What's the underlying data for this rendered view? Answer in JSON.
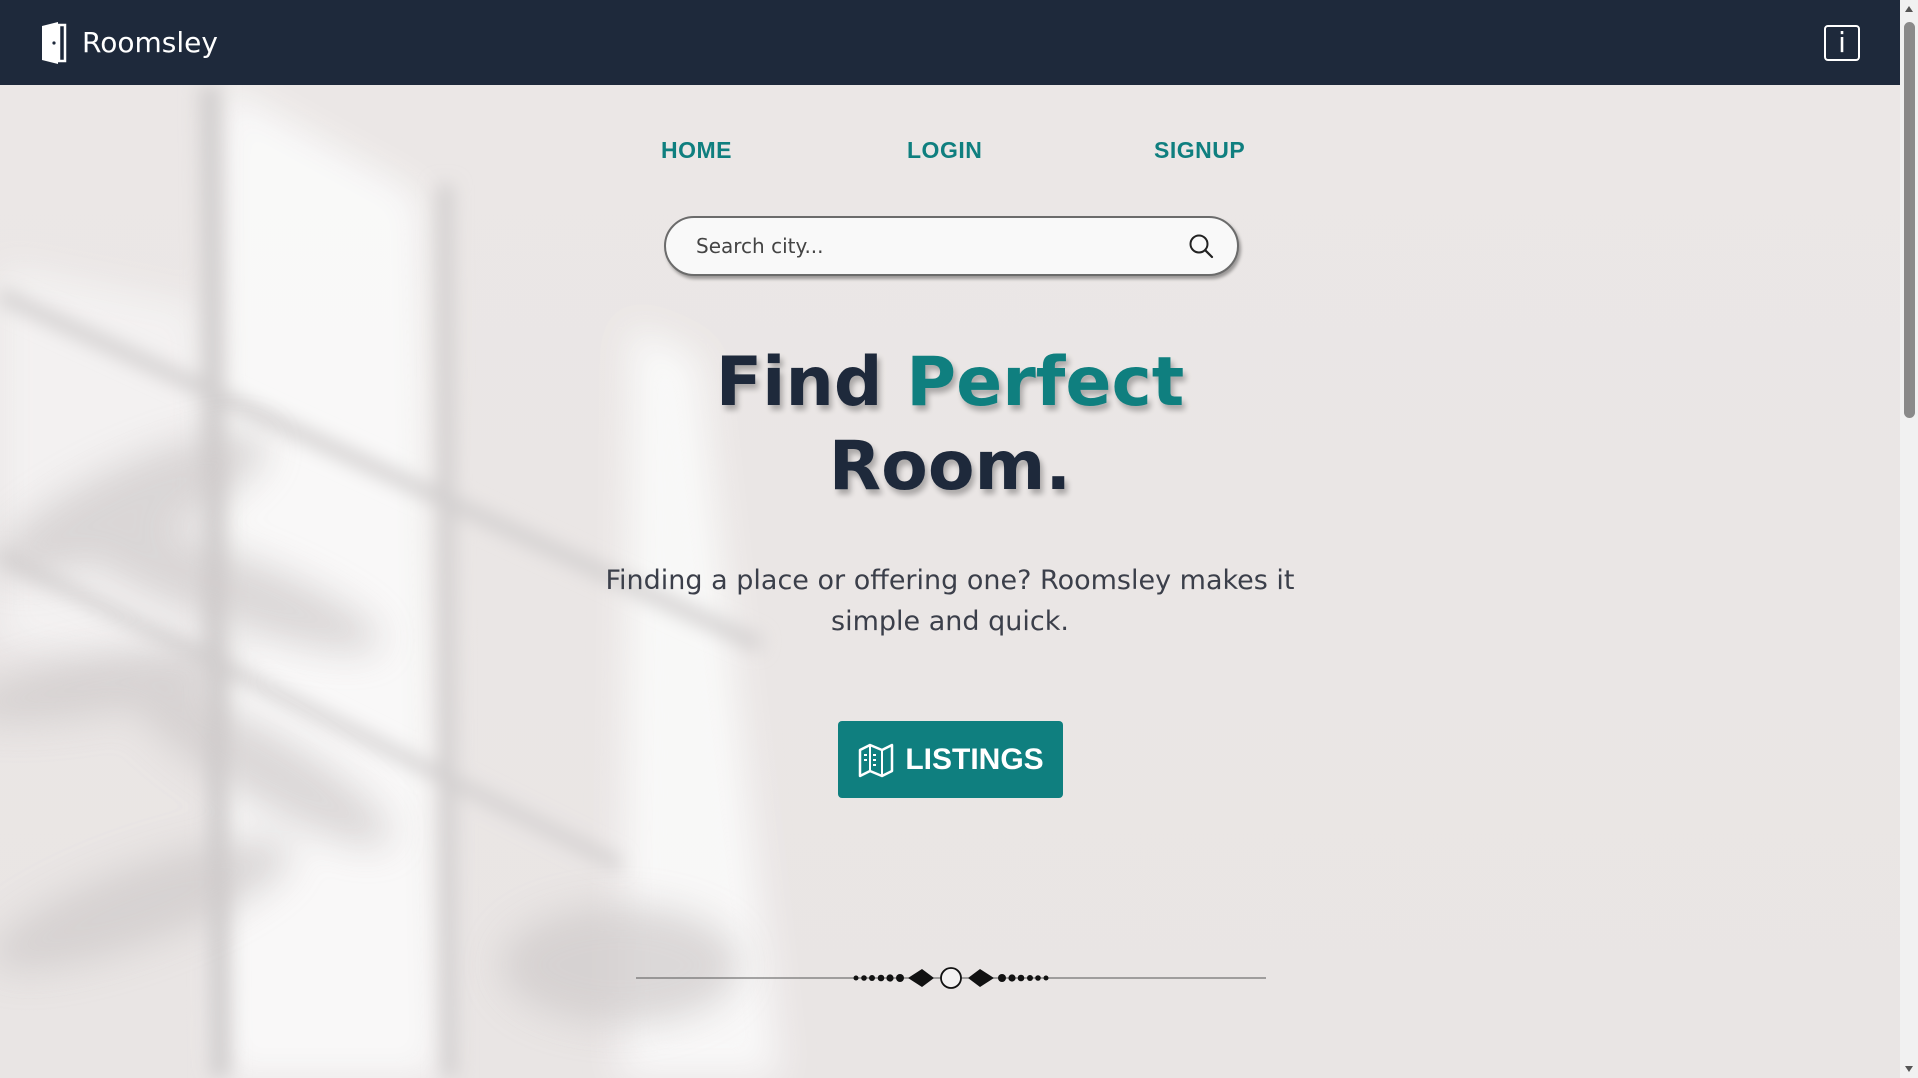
{
  "app": {
    "brand_name": "Roomsley",
    "logo_icon": "door-icon",
    "info_icon": "info-icon",
    "info_label": "i"
  },
  "nav": {
    "items": [
      {
        "label": "HOME"
      },
      {
        "label": "LOGIN"
      },
      {
        "label": "SIGNUP"
      }
    ]
  },
  "search": {
    "placeholder": "Search city...",
    "value": "",
    "icon": "search-icon"
  },
  "hero": {
    "headline_part1": "Find",
    "headline_accent": "Perfect",
    "headline_part2": "Room.",
    "subtitle": "Finding a place or offering one? Roomsley makes it simple and quick.",
    "cta_label": "LISTINGS",
    "cta_icon": "map-icon"
  },
  "colors": {
    "header_bg": "#1e293b",
    "accent": "#0f7f7f",
    "headline": "#1e293b",
    "text": "#3b3f4a"
  }
}
